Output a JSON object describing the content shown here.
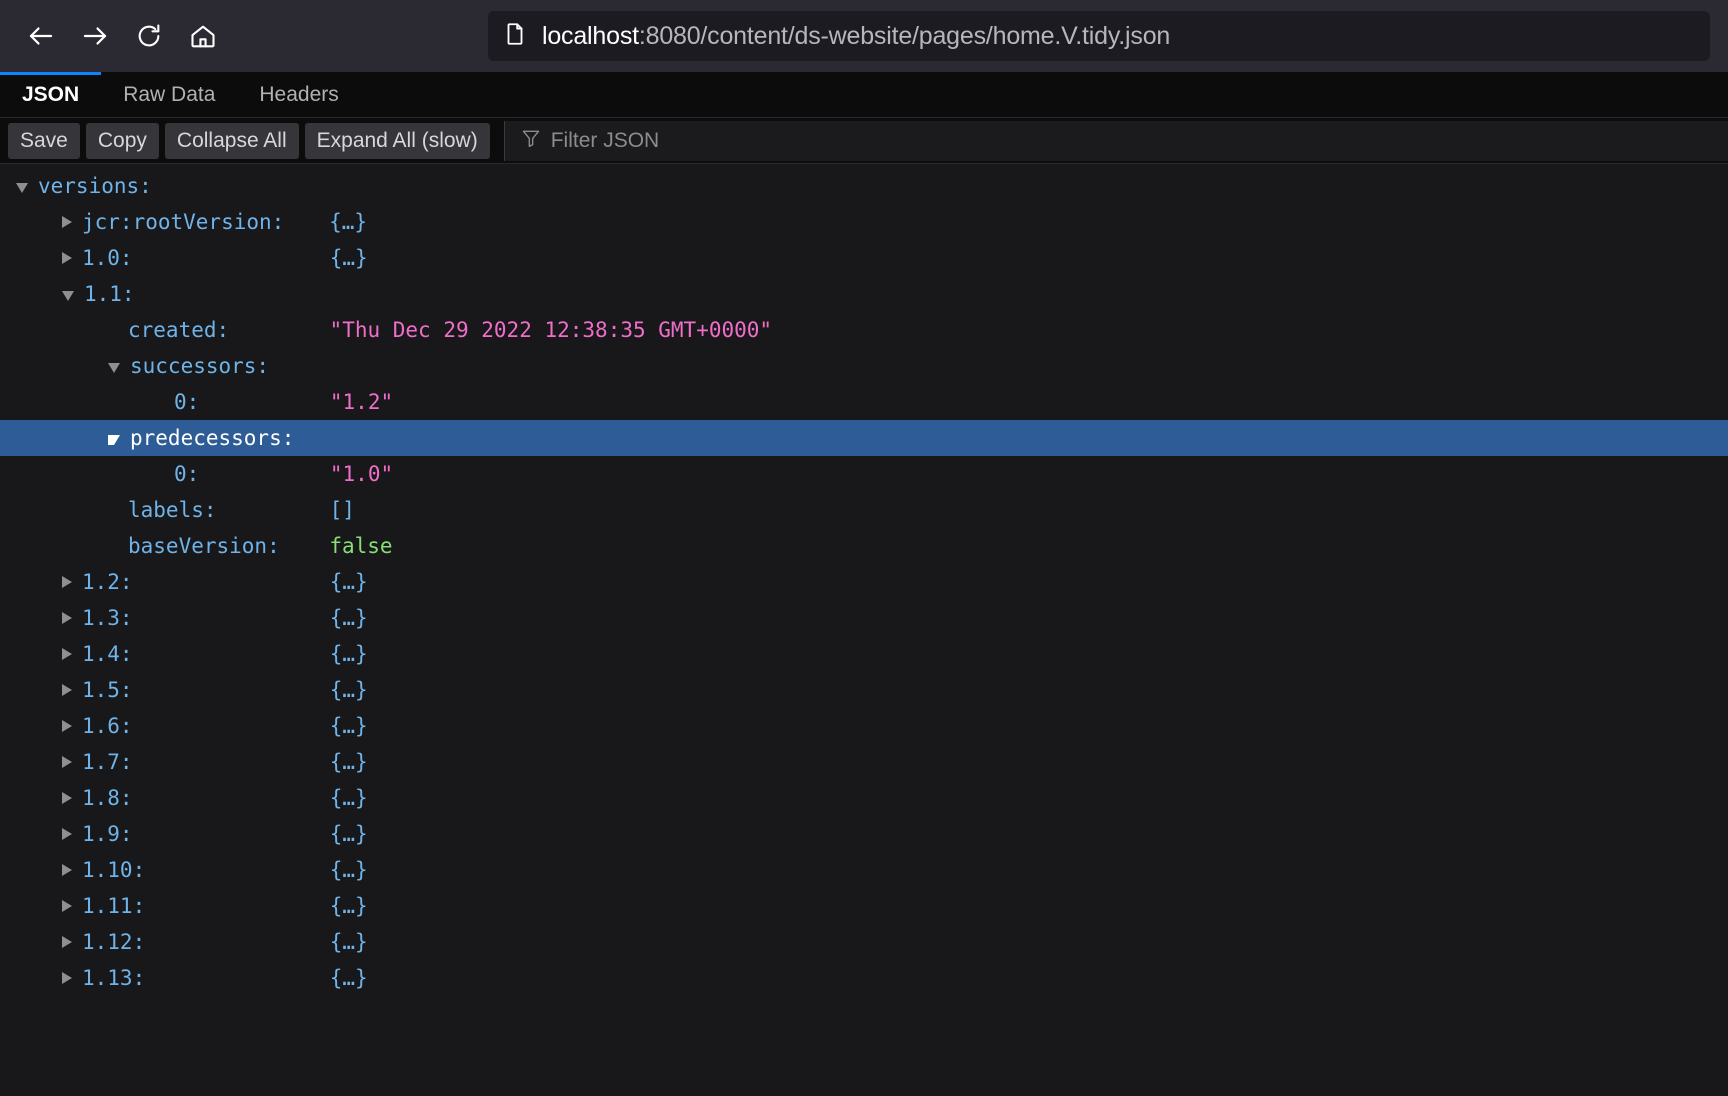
{
  "browser": {
    "nav": [
      {
        "name": "back-button",
        "icon": "arrow-left-icon"
      },
      {
        "name": "forward-button",
        "icon": "arrow-right-icon"
      },
      {
        "name": "reload-button",
        "icon": "reload-icon"
      },
      {
        "name": "home-button",
        "icon": "home-icon"
      }
    ],
    "url": {
      "icon": "document-icon",
      "host": "localhost",
      "rest": ":8080/content/ds-website/pages/home.V.tidy.json",
      "full": "localhost:8080/content/ds-website/pages/home.V.tidy.json"
    }
  },
  "viewer": {
    "tabs": [
      {
        "label": "JSON",
        "active": true
      },
      {
        "label": "Raw Data",
        "active": false
      },
      {
        "label": "Headers",
        "active": false
      }
    ],
    "toolbar": {
      "save_label": "Save",
      "copy_label": "Copy",
      "collapse_label": "Collapse All",
      "expand_label": "Expand All (slow)",
      "filter_icon": "funnel-icon",
      "filter_placeholder": "Filter JSON",
      "filter_value": ""
    },
    "accent_color": "#0a84ff",
    "selection_color": "#2e5c96",
    "key_color": "#6fb3e8",
    "string_color": "#f06eca",
    "boolean_color": "#86de74"
  },
  "json_rows": [
    {
      "indent": 0,
      "twisty": "open",
      "key": "versions:",
      "value": "",
      "vtype": "none",
      "selected": false
    },
    {
      "indent": 1,
      "twisty": "closed",
      "key": "jcr:rootVersion:",
      "value": "{…}",
      "vtype": "obj",
      "selected": false
    },
    {
      "indent": 1,
      "twisty": "closed",
      "key": "1.0:",
      "value": "{…}",
      "vtype": "obj",
      "selected": false
    },
    {
      "indent": 1,
      "twisty": "open",
      "key": "1.1:",
      "value": "",
      "vtype": "none",
      "selected": false
    },
    {
      "indent": 2,
      "twisty": "none",
      "key": "created:",
      "value": "\"Thu Dec 29 2022 12:38:35 GMT+0000\"",
      "vtype": "str",
      "selected": false
    },
    {
      "indent": 2,
      "twisty": "open",
      "key": "successors:",
      "value": "",
      "vtype": "none",
      "selected": false
    },
    {
      "indent": 3,
      "twisty": "none",
      "key": "0:",
      "value": "\"1.2\"",
      "vtype": "str",
      "selected": false
    },
    {
      "indent": 2,
      "twisty": "open",
      "key": "predecessors:",
      "value": "",
      "vtype": "none",
      "selected": true
    },
    {
      "indent": 3,
      "twisty": "none",
      "key": "0:",
      "value": "\"1.0\"",
      "vtype": "str",
      "selected": false
    },
    {
      "indent": 2,
      "twisty": "none",
      "key": "labels:",
      "value": "[]",
      "vtype": "arr",
      "selected": false
    },
    {
      "indent": 2,
      "twisty": "none",
      "key": "baseVersion:",
      "value": "false",
      "vtype": "bool",
      "selected": false
    },
    {
      "indent": 1,
      "twisty": "closed",
      "key": "1.2:",
      "value": "{…}",
      "vtype": "obj",
      "selected": false
    },
    {
      "indent": 1,
      "twisty": "closed",
      "key": "1.3:",
      "value": "{…}",
      "vtype": "obj",
      "selected": false
    },
    {
      "indent": 1,
      "twisty": "closed",
      "key": "1.4:",
      "value": "{…}",
      "vtype": "obj",
      "selected": false
    },
    {
      "indent": 1,
      "twisty": "closed",
      "key": "1.5:",
      "value": "{…}",
      "vtype": "obj",
      "selected": false
    },
    {
      "indent": 1,
      "twisty": "closed",
      "key": "1.6:",
      "value": "{…}",
      "vtype": "obj",
      "selected": false
    },
    {
      "indent": 1,
      "twisty": "closed",
      "key": "1.7:",
      "value": "{…}",
      "vtype": "obj",
      "selected": false
    },
    {
      "indent": 1,
      "twisty": "closed",
      "key": "1.8:",
      "value": "{…}",
      "vtype": "obj",
      "selected": false
    },
    {
      "indent": 1,
      "twisty": "closed",
      "key": "1.9:",
      "value": "{…}",
      "vtype": "obj",
      "selected": false
    },
    {
      "indent": 1,
      "twisty": "closed",
      "key": "1.10:",
      "value": "{…}",
      "vtype": "obj",
      "selected": false
    },
    {
      "indent": 1,
      "twisty": "closed",
      "key": "1.11:",
      "value": "{…}",
      "vtype": "obj",
      "selected": false
    },
    {
      "indent": 1,
      "twisty": "closed",
      "key": "1.12:",
      "value": "{…}",
      "vtype": "obj",
      "selected": false
    },
    {
      "indent": 1,
      "twisty": "closed",
      "key": "1.13:",
      "value": "{…}",
      "vtype": "obj",
      "selected": false
    }
  ]
}
